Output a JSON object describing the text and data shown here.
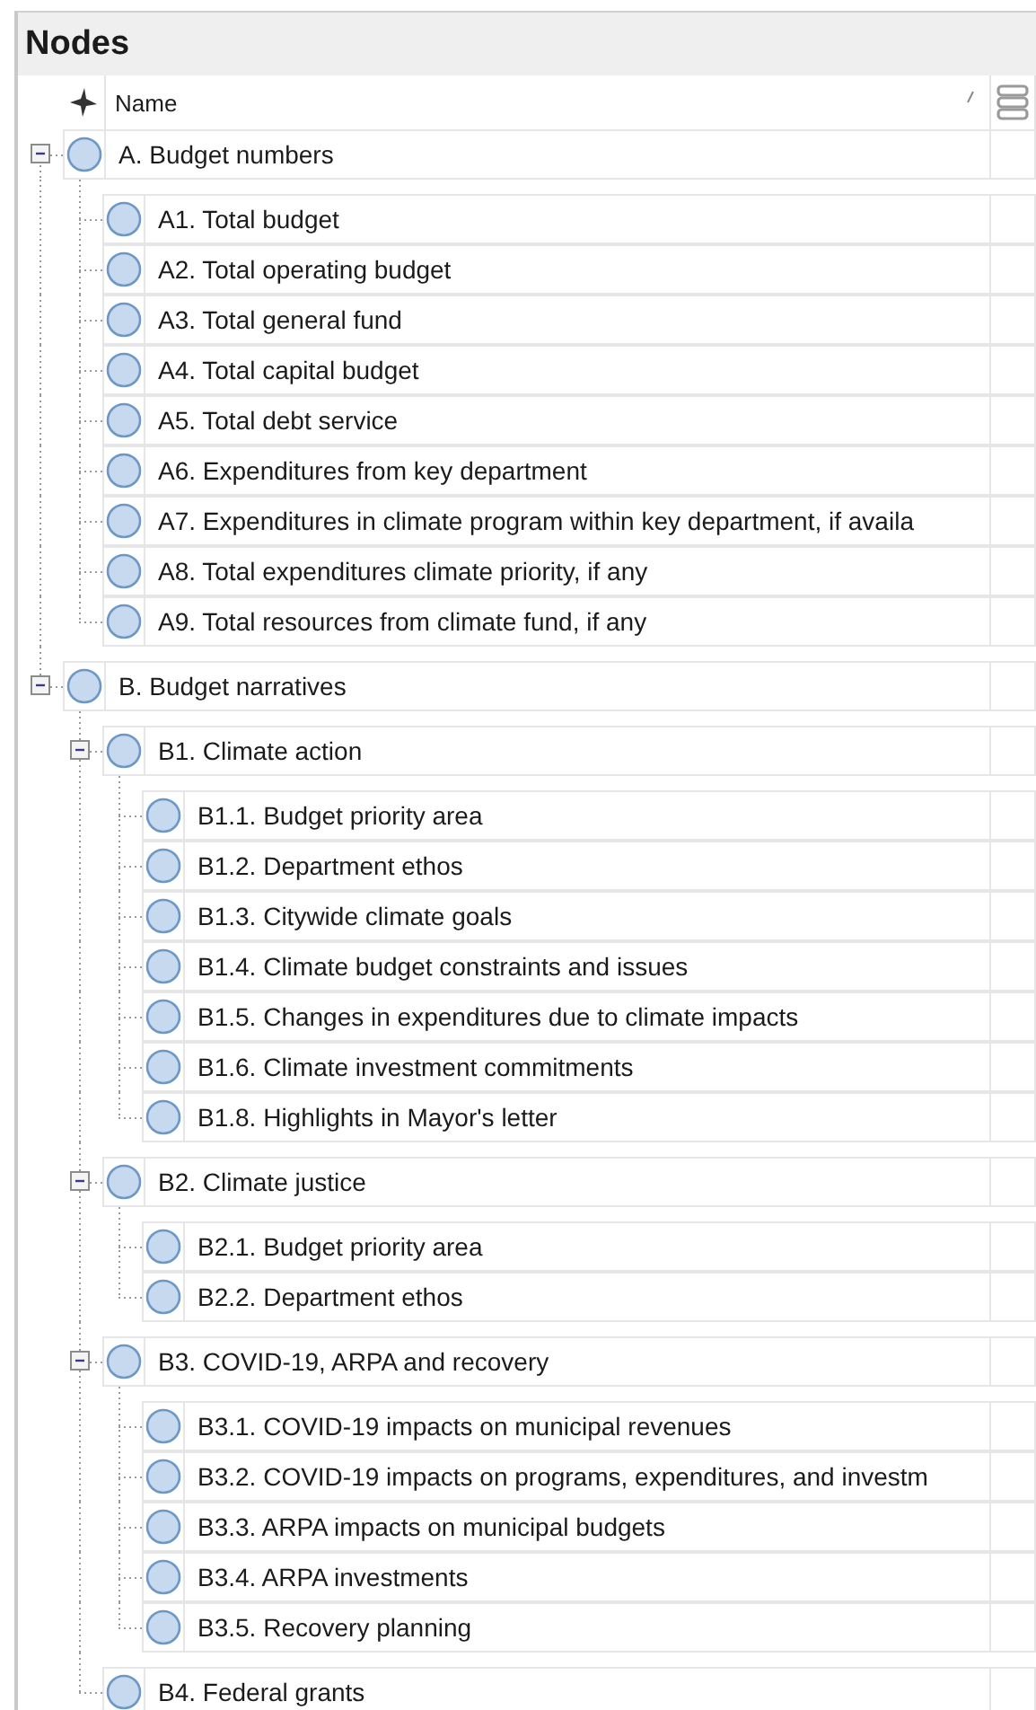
{
  "panel": {
    "title": "Nodes"
  },
  "columns": {
    "name": "Name"
  },
  "nodes": [
    {
      "name": "A. Budget numbers",
      "expanded": true,
      "children": [
        {
          "name": "A1. Total budget"
        },
        {
          "name": "A2. Total operating budget"
        },
        {
          "name": "A3. Total general fund"
        },
        {
          "name": "A4. Total capital budget"
        },
        {
          "name": "A5. Total debt service"
        },
        {
          "name": "A6. Expenditures from key department"
        },
        {
          "name": "A7. Expenditures in climate program within key department, if availa"
        },
        {
          "name": "A8. Total expenditures climate priority, if any"
        },
        {
          "name": "A9. Total resources from climate fund, if any"
        }
      ]
    },
    {
      "name": "B. Budget narratives",
      "expanded": true,
      "children": [
        {
          "name": "B1. Climate action",
          "expanded": true,
          "children": [
            {
              "name": "B1.1. Budget priority area"
            },
            {
              "name": "B1.2. Department ethos"
            },
            {
              "name": "B1.3. Citywide climate goals"
            },
            {
              "name": "B1.4. Climate budget constraints and issues"
            },
            {
              "name": "B1.5. Changes in expenditures due to climate impacts"
            },
            {
              "name": "B1.6. Climate investment commitments"
            },
            {
              "name": "B1.8. Highlights in Mayor's letter"
            }
          ]
        },
        {
          "name": "B2. Climate justice",
          "expanded": true,
          "children": [
            {
              "name": "B2.1. Budget priority area"
            },
            {
              "name": "B2.2. Department ethos"
            }
          ]
        },
        {
          "name": "B3. COVID-19, ARPA and recovery",
          "expanded": true,
          "children": [
            {
              "name": "B3.1. COVID-19 impacts on municipal revenues"
            },
            {
              "name": "B3.2. COVID-19 impacts on programs, expenditures, and investm"
            },
            {
              "name": "B3.3. ARPA impacts on municipal budgets"
            },
            {
              "name": "B3.4. ARPA investments"
            },
            {
              "name": "B3.5. Recovery planning"
            }
          ]
        },
        {
          "name": "B4. Federal grants"
        }
      ]
    }
  ]
}
